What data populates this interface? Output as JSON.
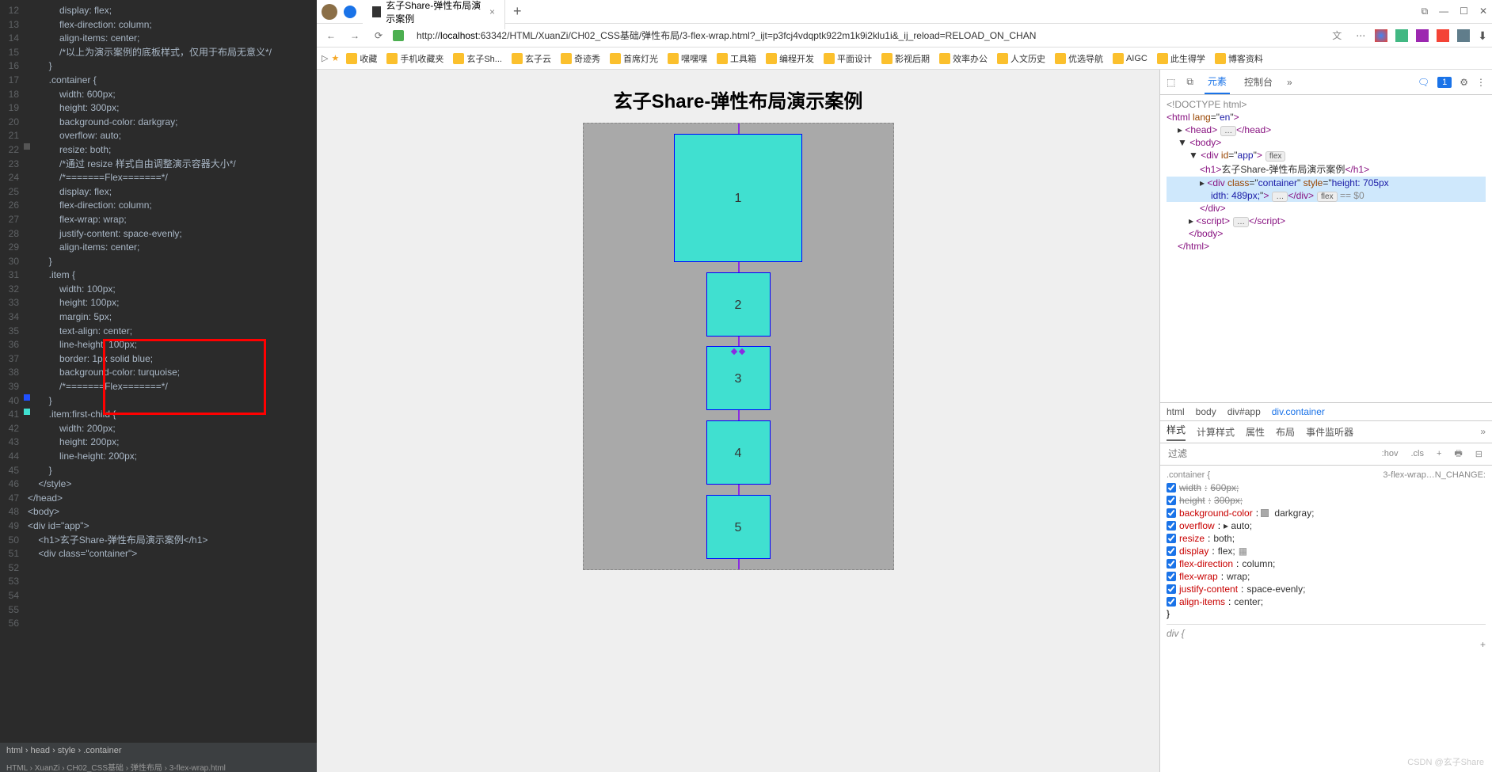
{
  "editor": {
    "lines": [
      12,
      13,
      14,
      15,
      16,
      17,
      18,
      19,
      20,
      21,
      22,
      23,
      24,
      25,
      26,
      27,
      28,
      29,
      30,
      31,
      32,
      33,
      34,
      35,
      36,
      37,
      38,
      39,
      40,
      41,
      42,
      43,
      44,
      45,
      46,
      47,
      48,
      49,
      50,
      51,
      52,
      53,
      54,
      55,
      56
    ],
    "c12": "            display: flex;",
    "c13": "            flex-direction: column;",
    "c14": "            align-items: center;",
    "c15": "            /*以上为演示案例的底板样式，仅用于布局无意义*/",
    "c16": "        }",
    "c19": "        .container {",
    "c20": "            width: 600px;",
    "c21": "            height: 300px;",
    "c22": "            background-color: darkgray;",
    "c23": "            overflow: auto;",
    "c24": "            resize: both;",
    "c25": "            /*通过 resize 样式自由调整演示容器大小*/",
    "c26": "            /*=======Flex=======*/",
    "c27": "            display: flex;",
    "c28": "            flex-direction: column;",
    "c29": "            flex-wrap: wrap;",
    "c30": "            justify-content: space-evenly;",
    "c31": "            align-items: center;",
    "c32": "        }",
    "c34": "        .item {",
    "c35": "            width: 100px;",
    "c36": "            height: 100px;",
    "c37": "            margin: 5px;",
    "c38": "            text-align: center;",
    "c39": "            line-height: 100px;",
    "c40": "            border: 1px solid blue;",
    "c41": "            background-color: turquoise;",
    "c42": "            /*=======Flex=======*/",
    "c43": "        }",
    "c45": "        .item:first-child {",
    "c46": "            width: 200px;",
    "c47": "            height: 200px;",
    "c48": "            line-height: 200px;",
    "c49": "        }",
    "c50": "    </style>",
    "c51": "</head>",
    "c52": "<body>",
    "c53": "<div id=\"app\">",
    "c54": "    <h1>玄子Share-弹性布局演示案例</h1>",
    "c55": "    <div class=\"container\">",
    "bread": "html › head › style › .container",
    "bread2": "HTML › XuanZi › CH02_CSS基础 › 弹性布局 › 3-flex-wrap.html"
  },
  "browser": {
    "tab": {
      "title": "玄子Share-弹性布局演示案例"
    },
    "url_prefix": "http://",
    "url_host": "localhost",
    "url_rest": ":63342/HTML/XuanZi/CH02_CSS基础/弹性布局/3-flex-wrap.html?_ijt=p3fcj4vdqptk922m1k9i2klu1i&_ij_reload=RELOAD_ON_CHAN",
    "bookmarks": [
      "收藏",
      "手机收藏夹",
      "玄子Sh...",
      "玄子云",
      "奇迹秀",
      "首席灯光",
      "嘿嘿嘿",
      "工具箱",
      "编程开发",
      "平面设计",
      "影视后期",
      "效率办公",
      "人文历史",
      "优选导航",
      "AIGC",
      "此生得学",
      "博客资料"
    ],
    "page_title": "玄子Share-弹性布局演示案例",
    "items": [
      "1",
      "2",
      "3",
      "4",
      "5"
    ]
  },
  "devtools": {
    "tabs": [
      "元素",
      "控制台"
    ],
    "badge": "1",
    "dom": {
      "doctype": "<!DOCTYPE html>",
      "html_open": "<html lang=\"en\">",
      "head": "<head>…</head>",
      "body_open": "<body>",
      "app_open": "<div id=\"app\">",
      "app_badge": "flex",
      "h1": "<h1>玄子Share-弹性布局演示案例</h1>",
      "container": "<div class=\"container\" style=\"height: 705px",
      "container2": "idth: 489px;\">…</div>",
      "container_badge": "flex",
      "container_eq": "== $0",
      "div_close": "</div>",
      "script": "<script>…</script>",
      "body_close": "</body>",
      "html_close": "</html>"
    },
    "crumbs": [
      "html",
      "body",
      "div#app",
      "div.container"
    ],
    "stabs": [
      "样式",
      "计算样式",
      "属性",
      "布局",
      "事件监听器"
    ],
    "filter_ph": "过滤",
    "hov": ":hov",
    "cls": ".cls",
    "rule_sel": ".container {",
    "rule_src": "3-flex-wrap…N_CHANGE:",
    "rules": [
      {
        "p": "width",
        "v": "600px;",
        "strike": true
      },
      {
        "p": "height",
        "v": "300px;",
        "strike": true
      },
      {
        "p": "background-color",
        "v": "darkgray;",
        "sw": "#a9a9a9"
      },
      {
        "p": "overflow",
        "v": "▸ auto;"
      },
      {
        "p": "resize",
        "v": "both;"
      },
      {
        "p": "display",
        "v": "flex;",
        "flexicon": true
      },
      {
        "p": "flex-direction",
        "v": "column;"
      },
      {
        "p": "flex-wrap",
        "v": "wrap;"
      },
      {
        "p": "justify-content",
        "v": "space-evenly;"
      },
      {
        "p": "align-items",
        "v": "center;"
      }
    ],
    "rule_close": "}",
    "div_rule": "div {"
  },
  "watermark": "CSDN @玄子Share"
}
